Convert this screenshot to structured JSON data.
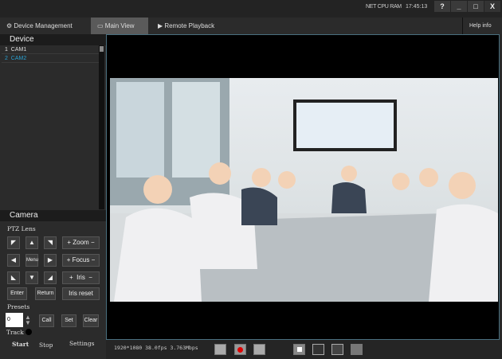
{
  "titlebar": {
    "stats": [
      "NET",
      "CPU",
      "RAM"
    ],
    "clock": "17:45:13",
    "help": "?",
    "minimize": "_",
    "maximize": "□",
    "close": "X"
  },
  "tabs": [
    {
      "label": "Device Management",
      "icon": "devices-icon"
    },
    {
      "label": "Main View",
      "icon": "monitor-icon",
      "active": true
    },
    {
      "label": "Remote Playback",
      "icon": "playback-icon"
    }
  ],
  "help_info": "Help info",
  "device": {
    "title": "Device",
    "items": [
      {
        "index": "1",
        "name": "CAM1"
      },
      {
        "index": "2",
        "name": "CAM2",
        "selected": true
      }
    ]
  },
  "camera": {
    "title": "Camera",
    "ptz_label": "PTZ Lens",
    "menu": "Menu",
    "zoom": "Zoom",
    "focus": "Focus",
    "iris": "Iris",
    "plus": "+",
    "minus": "−",
    "enter": "Enter",
    "return": "Return",
    "iris_reset": "Iris reset",
    "presets_label": "Presets",
    "preset_value": "0",
    "call": "Call",
    "set": "Set",
    "clear": "Clear",
    "track_label": "Track",
    "start": "Start",
    "stop": "Stop",
    "settings": "Settings"
  },
  "status": {
    "stream_info": "1920*1080 38.0fps 3.763Mbps"
  },
  "colors": {
    "accent": "#4a6f7f",
    "record": "#e00000",
    "selected_device": "#2aa0d0"
  }
}
